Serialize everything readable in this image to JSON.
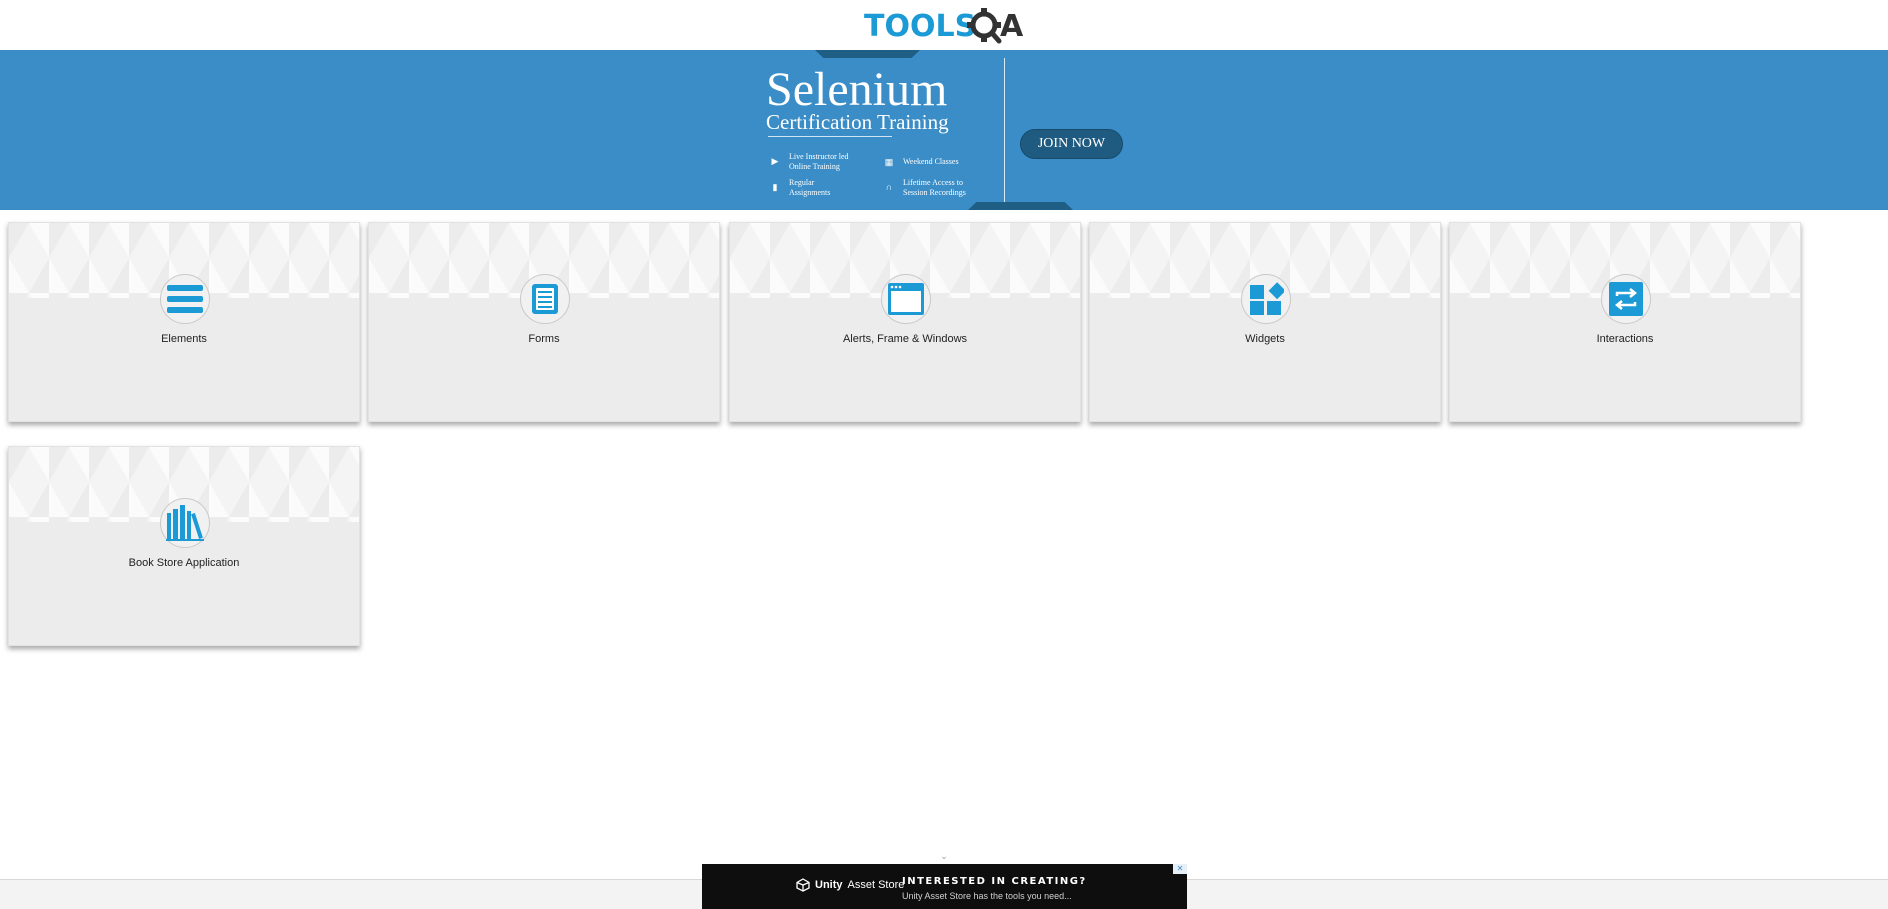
{
  "header": {
    "logo_text": "TOOLS",
    "logo_suffix": "A"
  },
  "banner": {
    "title": "Selenium",
    "subtitle": "Certification Training",
    "features": [
      {
        "icon": "play-icon",
        "text": "Live Instructor led Online Training"
      },
      {
        "icon": "calendar-icon",
        "text": "Weekend Classes"
      },
      {
        "icon": "document-icon",
        "text": "Regular Assignments"
      },
      {
        "icon": "headphones-icon",
        "text": "Lifetime Access to Session Recordings"
      }
    ],
    "cta_label": "JOIN NOW",
    "colors": {
      "background": "#3a8dc6",
      "button": "#1f5a80"
    }
  },
  "cards": [
    {
      "label": "Elements",
      "icon": "hamburger-lines-icon"
    },
    {
      "label": "Forms",
      "icon": "form-document-icon"
    },
    {
      "label": "Alerts, Frame & Windows",
      "icon": "browser-window-icon"
    },
    {
      "label": "Widgets",
      "icon": "widget-blocks-icon"
    },
    {
      "label": "Interactions",
      "icon": "swap-arrows-icon"
    },
    {
      "label": "Book Store Application",
      "icon": "books-icon"
    }
  ],
  "ad": {
    "brand": "Unity",
    "brand_suffix": "Asset Store",
    "headline": "INTERESTED IN CREATING?",
    "text": "Unity Asset Store has the tools you need...",
    "close_label": "✕"
  },
  "accent_color": "#1b9ad6"
}
